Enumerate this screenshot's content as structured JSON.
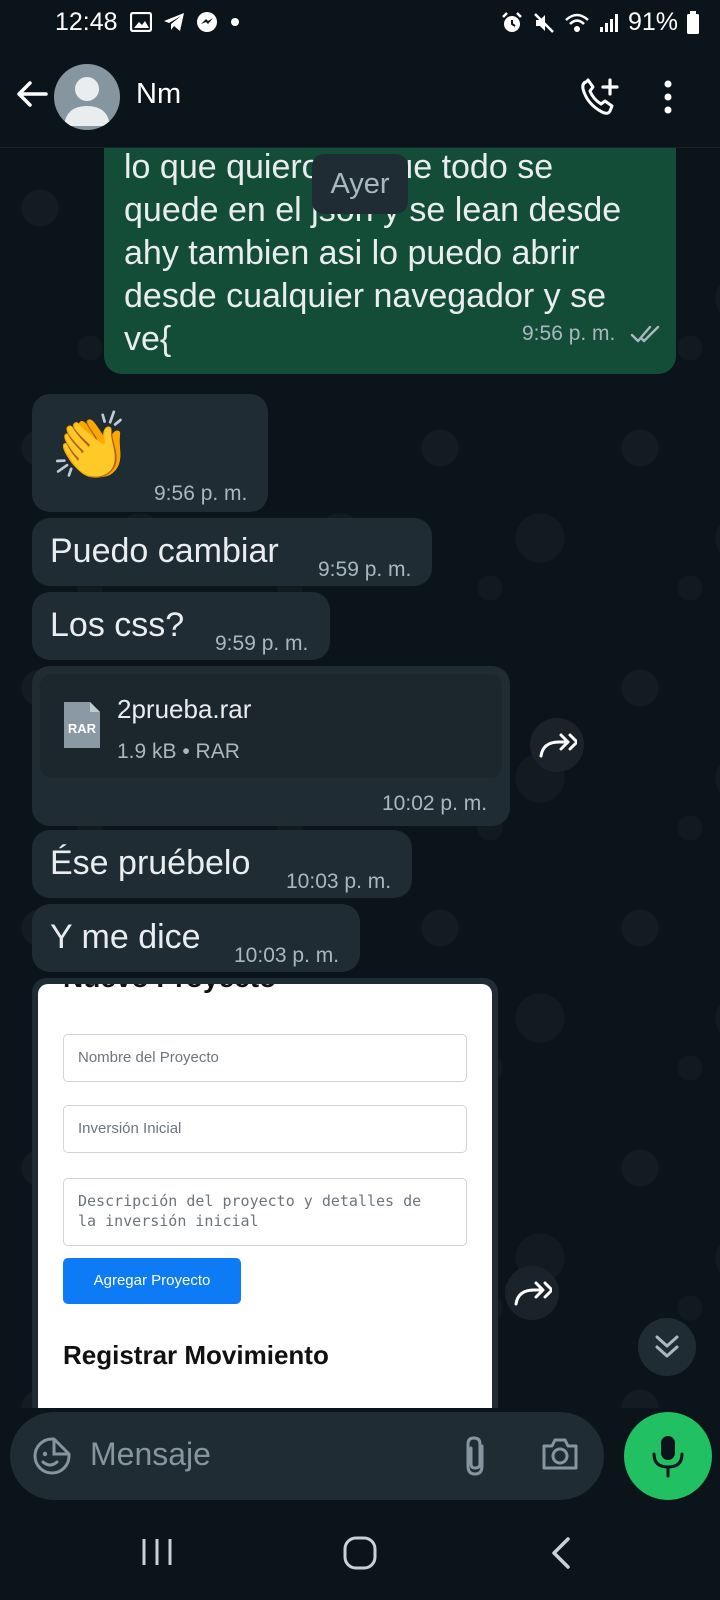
{
  "status_bar": {
    "time": "12:48",
    "battery": "91%",
    "left_icons": [
      "gallery-icon",
      "telegram-icon",
      "messenger-icon",
      "dot-icon"
    ],
    "right_icons": [
      "alarm-icon",
      "mute-icon",
      "wifi-icon",
      "signal-icon",
      "battery-icon"
    ]
  },
  "header": {
    "contact_name": "Nm"
  },
  "chat": {
    "date_label": "Ayer",
    "messages": [
      {
        "direction": "out",
        "text_lines": [
          "lo que quiero es que todo se",
          "quede en el json y se lean desde",
          "ahy tambien asi lo puedo abrir",
          "desde cualquier navegador y se",
          "ve{"
        ],
        "time": "9:56 p. m.",
        "status": "read"
      },
      {
        "direction": "in",
        "emoji": "👏",
        "time": "9:56 p. m."
      },
      {
        "direction": "in",
        "text": "Puedo cambiar",
        "time": "9:59 p. m."
      },
      {
        "direction": "in",
        "text": "Los css?",
        "time": "9:59 p. m."
      },
      {
        "direction": "in",
        "file": {
          "name": "2prueba.rar",
          "meta": "1.9 kB • RAR",
          "icon_label": "RAR"
        },
        "time": "10:02 p. m."
      },
      {
        "direction": "in",
        "text": "Ése pruébelo",
        "time": "10:03 p. m."
      },
      {
        "direction": "in",
        "text": "Y me dice",
        "time": "10:03 p. m."
      }
    ],
    "screenshot": {
      "cut_heading": "Nuevo Proyecto",
      "field_name_placeholder": "Nombre del Proyecto",
      "field_investment_placeholder": "Inversión Inicial",
      "field_description_placeholder": "Descripción del proyecto y detalles de la inversión inicial",
      "button_label": "Agregar Proyecto",
      "section_heading": "Registrar Movimiento"
    }
  },
  "composer": {
    "placeholder": "Mensaje"
  },
  "colors": {
    "outgoing_bubble": "#144d37",
    "incoming_bubble": "#1f2c34",
    "background": "#0b141a",
    "mic_button": "#21c063",
    "screenshot_button": "#0d7bf5",
    "read_ticks": "#a9b8c0"
  }
}
